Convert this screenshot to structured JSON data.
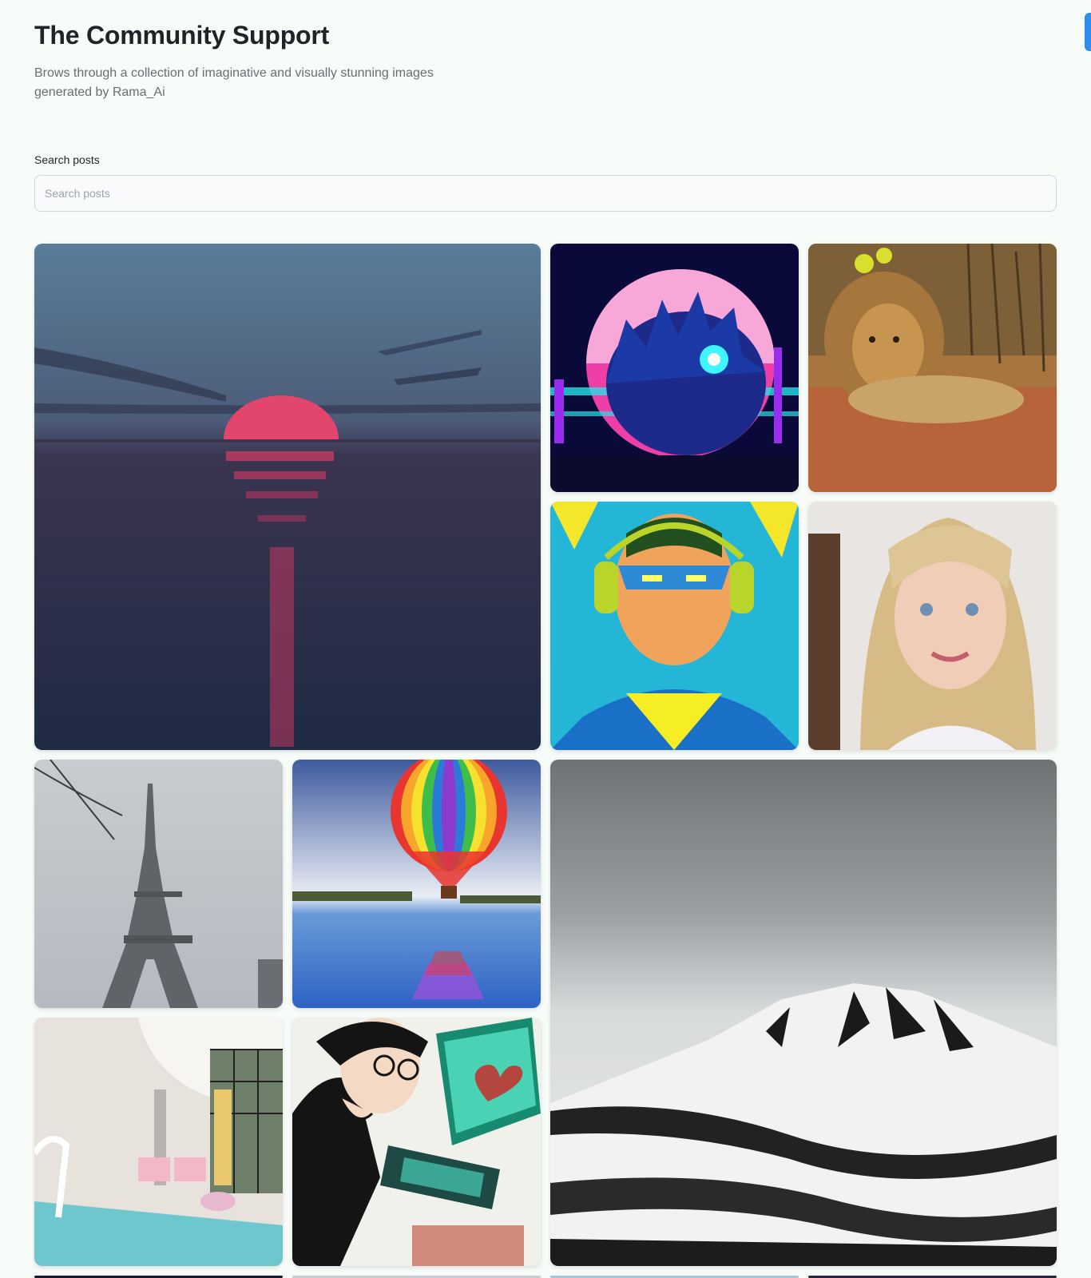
{
  "header": {
    "title": "The Community Support",
    "subtitle": "Brows through a collection of imaginative and visually stunning images generated by Rama_Ai"
  },
  "search": {
    "label": "Search posts",
    "placeholder": "Search posts",
    "value": ""
  },
  "gallery": {
    "posts": [
      {
        "subject": "sunset over sea"
      },
      {
        "subject": "neon hedgehog"
      },
      {
        "subject": "lion resting"
      },
      {
        "subject": "superhero with headphones"
      },
      {
        "subject": "blonde child portrait"
      },
      {
        "subject": "eiffel tower"
      },
      {
        "subject": "rainbow hot air balloon"
      },
      {
        "subject": "snowy mountain"
      },
      {
        "subject": "modern interior with pool"
      },
      {
        "subject": "person at computer with heart"
      }
    ]
  },
  "colors": {
    "accent": "#2b8ff0",
    "background": "#f8fcf9",
    "title": "#222328",
    "subtitle": "#666e75"
  }
}
